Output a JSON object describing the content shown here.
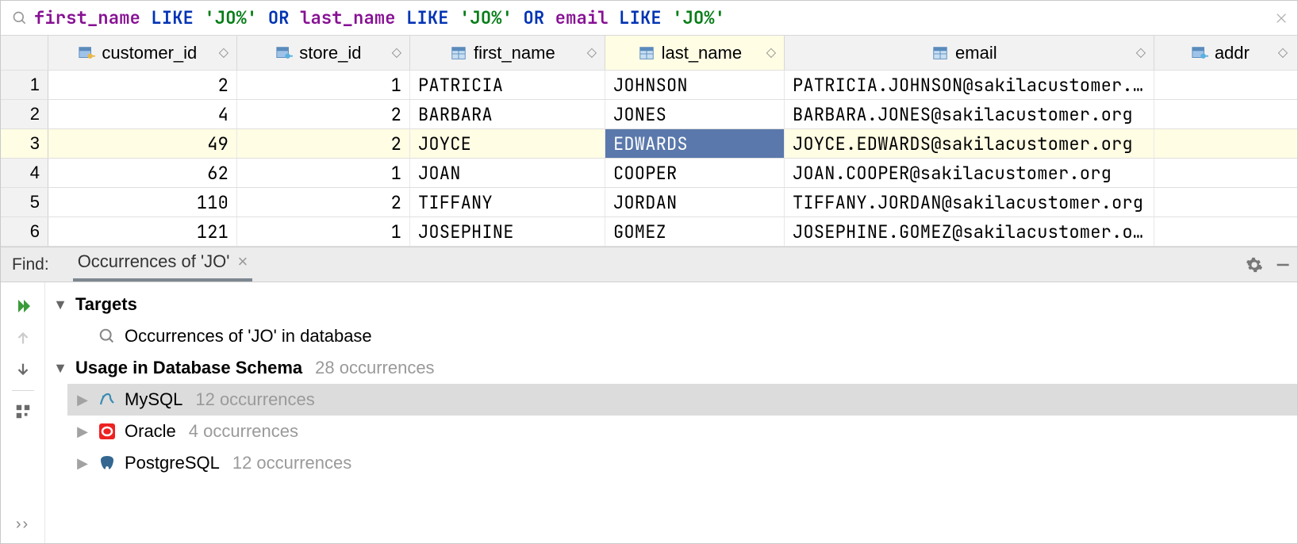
{
  "filter": {
    "parts": [
      {
        "t": "first_name",
        "c": "col"
      },
      {
        "t": " ",
        "c": ""
      },
      {
        "t": "LIKE",
        "c": "kw"
      },
      {
        "t": " ",
        "c": ""
      },
      {
        "t": "'JO%'",
        "c": "str"
      },
      {
        "t": " ",
        "c": ""
      },
      {
        "t": "OR",
        "c": "kw"
      },
      {
        "t": " ",
        "c": ""
      },
      {
        "t": "last_name",
        "c": "col"
      },
      {
        "t": " ",
        "c": ""
      },
      {
        "t": "LIKE",
        "c": "kw"
      },
      {
        "t": " ",
        "c": ""
      },
      {
        "t": "'JO%'",
        "c": "str"
      },
      {
        "t": " ",
        "c": ""
      },
      {
        "t": "OR",
        "c": "kw"
      },
      {
        "t": " ",
        "c": ""
      },
      {
        "t": "email",
        "c": "col"
      },
      {
        "t": " ",
        "c": ""
      },
      {
        "t": "LIKE",
        "c": "kw"
      },
      {
        "t": " ",
        "c": ""
      },
      {
        "t": "'JO%'",
        "c": "str"
      }
    ]
  },
  "cols": [
    {
      "name": "customer_id",
      "icon": "pk"
    },
    {
      "name": "store_id",
      "icon": "fk"
    },
    {
      "name": "first_name",
      "icon": "col"
    },
    {
      "name": "last_name",
      "icon": "col"
    },
    {
      "name": "email",
      "icon": "col"
    },
    {
      "name": "addr",
      "icon": "fk"
    }
  ],
  "rows": [
    {
      "n": "1",
      "customer_id": "2",
      "store_id": "1",
      "first_name": "PATRICIA",
      "last_name": "JOHNSON",
      "email": "PATRICIA.JOHNSON@sakilacustomer.…"
    },
    {
      "n": "2",
      "customer_id": "4",
      "store_id": "2",
      "first_name": "BARBARA",
      "last_name": "JONES",
      "email": "BARBARA.JONES@sakilacustomer.org"
    },
    {
      "n": "3",
      "customer_id": "49",
      "store_id": "2",
      "first_name": "JOYCE",
      "last_name": "EDWARDS",
      "email": "JOYCE.EDWARDS@sakilacustomer.org",
      "hl": true,
      "selCol": "last_name"
    },
    {
      "n": "4",
      "customer_id": "62",
      "store_id": "1",
      "first_name": "JOAN",
      "last_name": "COOPER",
      "email": "JOAN.COOPER@sakilacustomer.org"
    },
    {
      "n": "5",
      "customer_id": "110",
      "store_id": "2",
      "first_name": "TIFFANY",
      "last_name": "JORDAN",
      "email": "TIFFANY.JORDAN@sakilacustomer.org"
    },
    {
      "n": "6",
      "customer_id": "121",
      "store_id": "1",
      "first_name": "JOSEPHINE",
      "last_name": "GOMEZ",
      "email": "JOSEPHINE.GOMEZ@sakilacustomer.o…"
    }
  ],
  "find": {
    "label": "Find:",
    "tab": "Occurrences of 'JO'",
    "targets_label": "Targets",
    "targets_desc": "Occurrences of 'JO' in database",
    "usage_label": "Usage in Database Schema",
    "usage_total": "28 occurrences",
    "sources": [
      {
        "name": "MySQL",
        "count": "12 occurrences",
        "icon": "mysql",
        "sel": true
      },
      {
        "name": "Oracle",
        "count": "4 occurrences",
        "icon": "oracle"
      },
      {
        "name": "PostgreSQL",
        "count": "12 occurrences",
        "icon": "postgres"
      }
    ]
  }
}
